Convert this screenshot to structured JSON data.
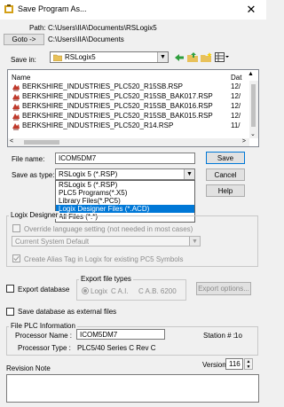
{
  "window": {
    "title": "Save Program As...",
    "close_glyph": "✕"
  },
  "path": {
    "label": "Path:",
    "value": "C:\\Users\\IIA\\Documents\\RSLogix5"
  },
  "goto": {
    "button_label": "Goto ->",
    "value": "C:\\Users\\IIA\\Documents"
  },
  "save_in": {
    "label": "Save in:",
    "value": "RSLogix5"
  },
  "file_list": {
    "header_name": "Name",
    "header_date": "Dat",
    "files": [
      {
        "name": "BERKSHIRE_INDUSTRIES_PLC520_R15SB.RSP",
        "date": "12/"
      },
      {
        "name": "BERKSHIRE_INDUSTRIES_PLC520_R15SB_BAK017.RSP",
        "date": "12/"
      },
      {
        "name": "BERKSHIRE_INDUSTRIES_PLC520_R15SB_BAK016.RSP",
        "date": "12/"
      },
      {
        "name": "BERKSHIRE_INDUSTRIES_PLC520_R15SB_BAK015.RSP",
        "date": "12/"
      },
      {
        "name": "BERKSHIRE_INDUSTRIES_PLC520_R14.RSP",
        "date": "11/"
      }
    ]
  },
  "file_name": {
    "label": "File name:",
    "value": "ICOM5DM7"
  },
  "save_as_type": {
    "label": "Save as type:",
    "value": "RSLogix 5 (*.RSP)",
    "options": [
      "RSLogix 5 (*.RSP)",
      "PLC5 Programs(*.X5)",
      "Library Files(*.PC5)",
      "Logix Designer Files (*.ACD)",
      "All Files (*.*)"
    ],
    "selected_option": "Logix Designer Files (*.ACD)"
  },
  "buttons": {
    "save": "Save",
    "cancel": "Cancel",
    "help": "Help"
  },
  "logix_group": {
    "title": "Logix Designer",
    "override_label": "Override language setting (not needed in most cases)",
    "language_value": "Current System Default",
    "alias_label": "Create Alias Tag in Logix for existing PC5 Symbols"
  },
  "export": {
    "checkbox_label": "Export database",
    "file_types_title": "Export file types",
    "radio_logix": "Logix",
    "radio_ai": "C A.I.",
    "radio_ab": "C A.B. 6200",
    "options_button": "Export options..."
  },
  "save_external": {
    "label": "Save database as external files"
  },
  "plc_info": {
    "title": "File PLC Information",
    "processor_name_label": "Processor Name :",
    "processor_name_value": "ICOM5DM7",
    "station_label": "Station # :",
    "station_value": "1o",
    "processor_type_label": "Processor Type :",
    "processor_type_value": "PLC5/40 Series C  Rev C"
  },
  "revision": {
    "note_label": "Revision Note",
    "version_label": "Version:",
    "version_value": "116",
    "note_value": ""
  }
}
